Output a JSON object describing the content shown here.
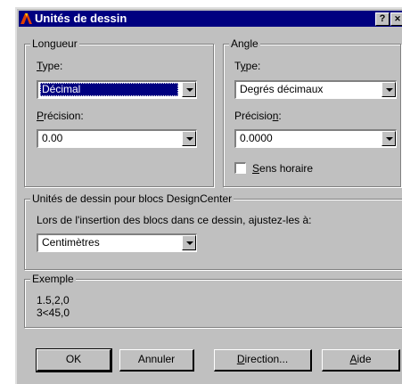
{
  "title": "Unités de dessin",
  "title_buttons": {
    "help": "?",
    "close": "x"
  },
  "length": {
    "group_label": "Longueur",
    "type_label": "Type:",
    "type_value": "Décimal",
    "precision_label": "Précision:",
    "precision_value": "0.00"
  },
  "angle": {
    "group_label": "Angle",
    "type_label": "Type:",
    "type_value": "Degrés décimaux",
    "precision_label": "Précision:",
    "precision_value": "0.0000",
    "clockwise_label": "Sens horaire",
    "clockwise_checked": false
  },
  "designcenter": {
    "group_label": "Unités de dessin pour blocs DesignCenter",
    "instruction": "Lors de l'insertion des blocs dans ce dessin, ajustez-les à:",
    "units_value": "Centimètres"
  },
  "example": {
    "group_label": "Exemple",
    "line1": "1.5,2,0",
    "line2": "3<45,0"
  },
  "buttons": {
    "ok": "OK",
    "cancel": "Annuler",
    "direction": "Direction...",
    "help": "Aide"
  },
  "colors": {
    "titlebar": "#000080",
    "face": "#c0c0c0",
    "selection": "#000080"
  }
}
